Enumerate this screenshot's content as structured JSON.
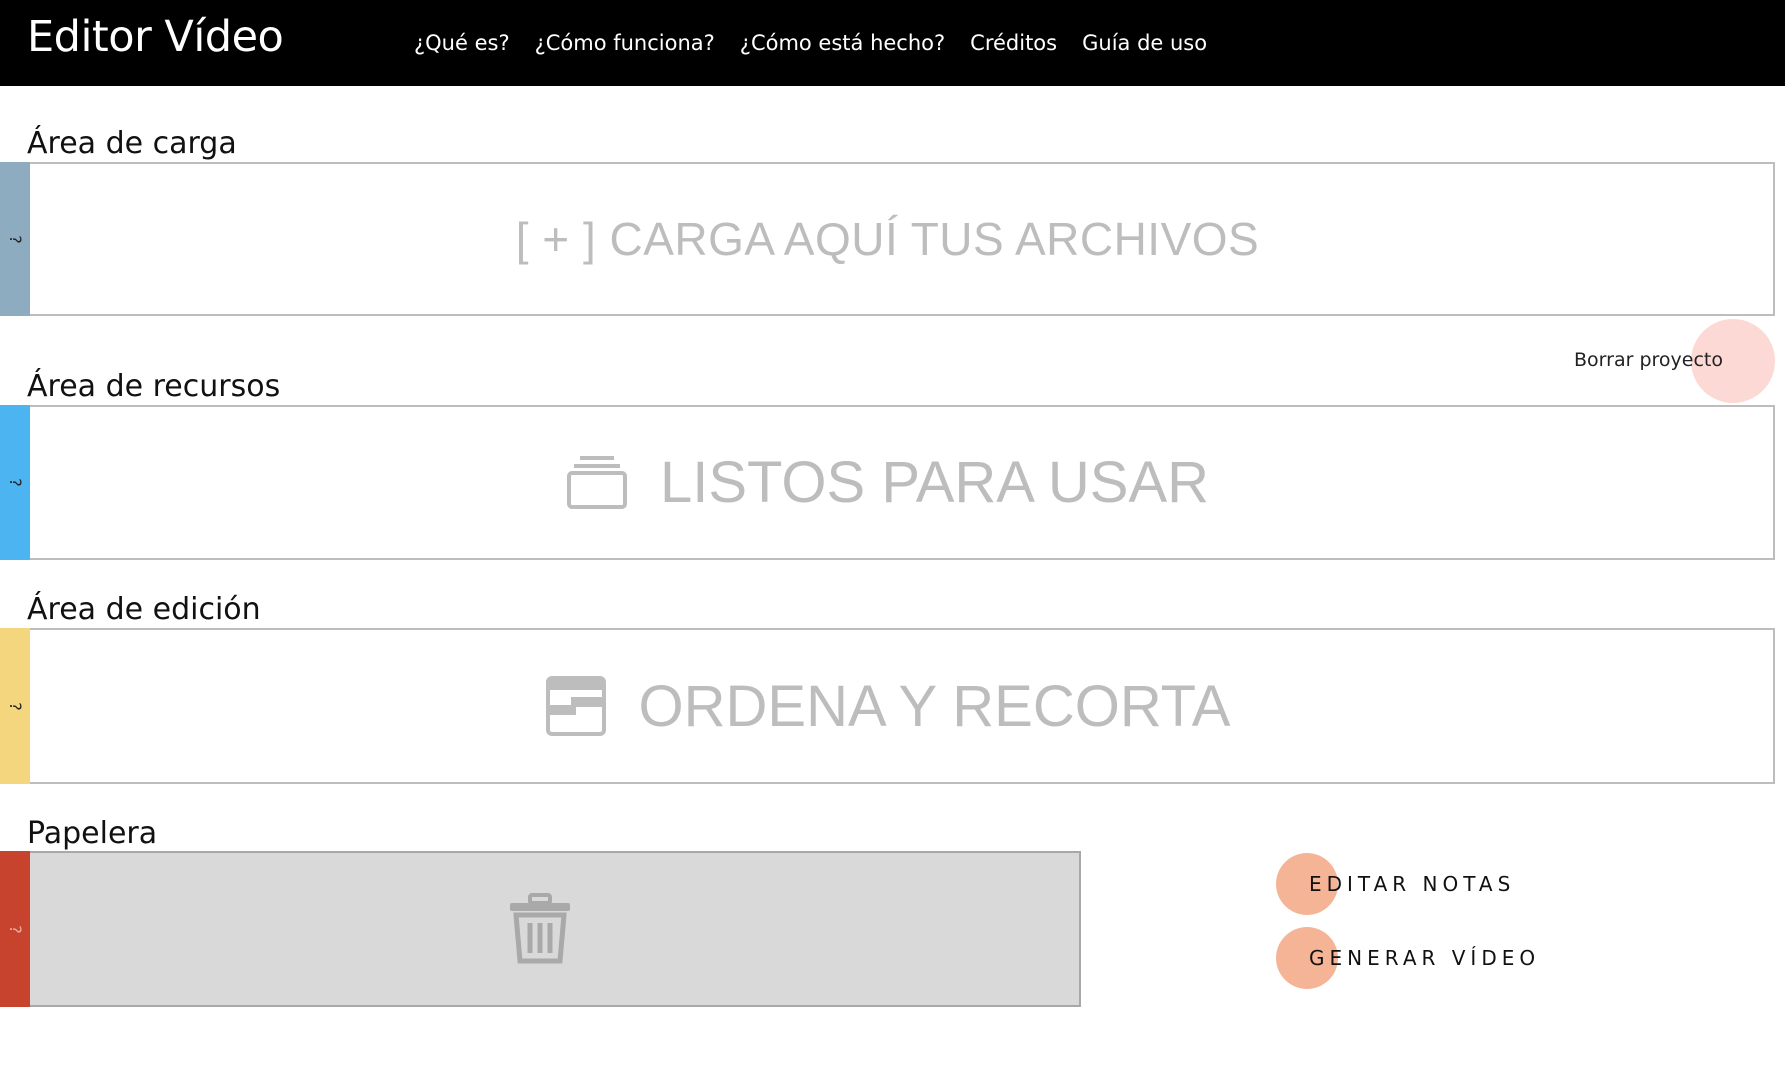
{
  "header": {
    "title": "Editor Vídeo",
    "nav": [
      "¿Qué es?",
      "¿Cómo funciona?",
      "¿Cómo está hecho?",
      "Créditos",
      "Guía de uso"
    ]
  },
  "areas": {
    "upload": {
      "title": "Área de carga",
      "help": "?",
      "tab_color": "#8eacbf",
      "placeholder": "[ + ] CARGA AQUÍ TUS ARCHIVOS"
    },
    "resources": {
      "title": "Área de recursos",
      "help": "?",
      "tab_color": "#4db4f2",
      "placeholder": "LISTOS PARA USAR",
      "icon": "stack-icon"
    },
    "editing": {
      "title": "Área de edición",
      "help": "?",
      "tab_color": "#f3d67d",
      "placeholder": "ORDENA Y RECORTA",
      "icon": "timeline-card-icon"
    },
    "trash": {
      "title": "Papelera",
      "help": "?",
      "tab_color": "#c8432e",
      "background": "#d9d9d9",
      "icon": "trash-icon"
    }
  },
  "actions": {
    "delete_project": "Borrar proyecto",
    "edit_notes": "EDITAR NOTAS",
    "generate_video": "GENERAR VÍDEO"
  },
  "colors": {
    "header_bg": "#000000",
    "placeholder_text": "#bdbdbd",
    "delete_circle": "#fcd9d4",
    "action_circle": "#f6b497"
  }
}
